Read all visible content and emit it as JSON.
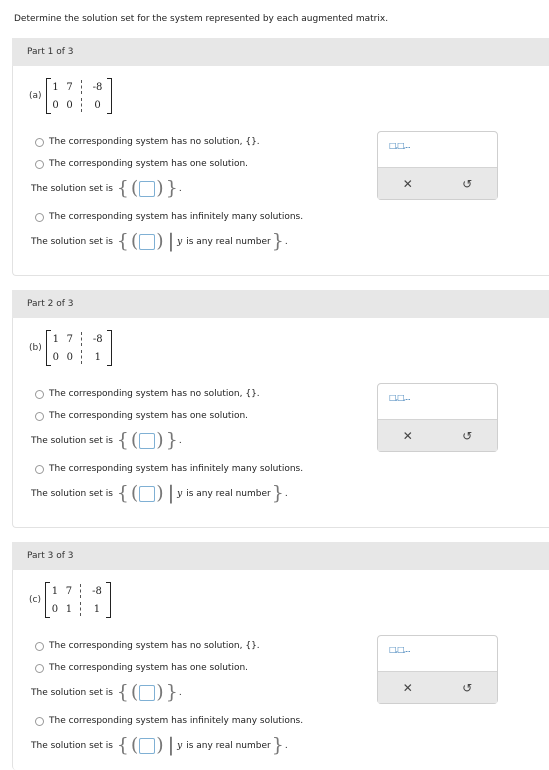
{
  "instruction": "Determine the solution set for the system represented by each augmented matrix.",
  "parts": [
    {
      "header": "Part 1 of 3",
      "label": "(a)",
      "matrix": [
        [
          "1",
          "7",
          "-8"
        ],
        [
          "0",
          "0",
          "0"
        ]
      ],
      "options": {
        "no_solution": "The corresponding system has no solution, {}.",
        "one_solution": "The corresponding system has one solution.",
        "infinite": "The corresponding system has infinitely many solutions."
      },
      "solution_set_label": "The solution set is",
      "variable": "y",
      "real_text": "is any real number"
    },
    {
      "header": "Part 2 of 3",
      "label": "(b)",
      "matrix": [
        [
          "1",
          "7",
          "-8"
        ],
        [
          "0",
          "0",
          "1"
        ]
      ],
      "options": {
        "no_solution": "The corresponding system has no solution, {}.",
        "one_solution": "The corresponding system has one solution.",
        "infinite": "The corresponding system has infinitely many solutions."
      },
      "solution_set_label": "The solution set is",
      "variable": "y",
      "real_text": "is any real number"
    },
    {
      "header": "Part 3 of 3",
      "label": "(c)",
      "matrix": [
        [
          "1",
          "7",
          "-8"
        ],
        [
          "0",
          "1",
          "1"
        ]
      ],
      "options": {
        "no_solution": "The corresponding system has no solution, {}.",
        "one_solution": "The corresponding system has one solution.",
        "infinite": "The corresponding system has infinitely many solutions."
      },
      "solution_set_label": "The solution set is",
      "variable": "y",
      "real_text": "is any real number"
    }
  ],
  "palette": {
    "tuple_icon": "□,□,...",
    "clear_symbol": "✕",
    "undo_symbol": "↺"
  }
}
